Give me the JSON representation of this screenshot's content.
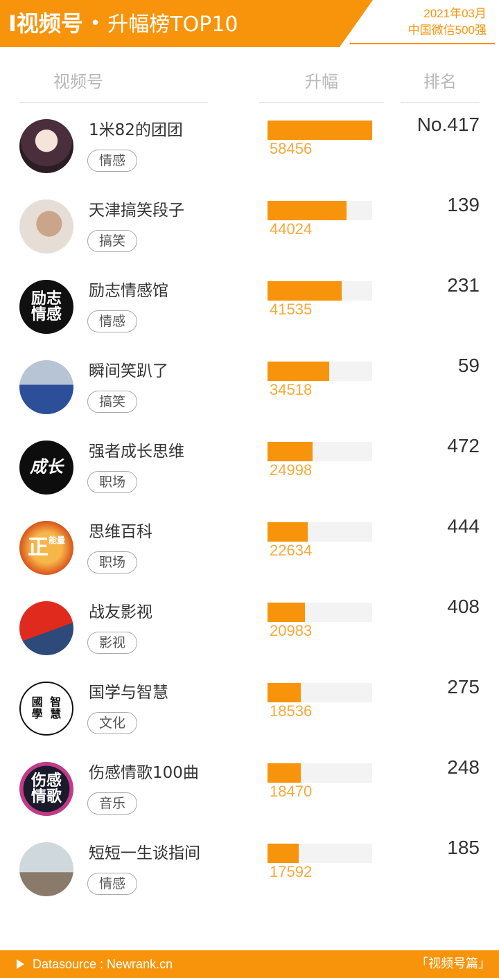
{
  "header": {
    "title_main": "I视频号",
    "title_dot": "•",
    "title_sub": "升幅榜TOP10",
    "date": "2021年03月",
    "subtitle": "中国微信500强"
  },
  "columns": {
    "account": "视频号",
    "increase": "升幅",
    "rank": "排名"
  },
  "bar_max": 58456,
  "rows": [
    {
      "name": "1米82的团团",
      "tag": "情感",
      "value": 58456,
      "value_label": "58456",
      "rank": "No.417",
      "avatar_icon": "anime-girl-avatar-icon"
    },
    {
      "name": "天津搞笑段子",
      "tag": "搞笑",
      "value": 44024,
      "value_label": "44024",
      "rank": "139",
      "avatar_icon": "woman-photo-avatar-icon"
    },
    {
      "name": "励志情感馆",
      "tag": "情感",
      "value": 41535,
      "value_label": "41535",
      "rank": "231",
      "avatar_icon": "text-logo-avatar-icon",
      "avatar_text": [
        "励志",
        "情感"
      ]
    },
    {
      "name": "瞬间笑趴了",
      "tag": "搞笑",
      "value": 34518,
      "value_label": "34518",
      "rank": "59",
      "avatar_icon": "man-on-tricycle-avatar-icon"
    },
    {
      "name": "强者成长思维",
      "tag": "职场",
      "value": 24998,
      "value_label": "24998",
      "rank": "472",
      "avatar_icon": "calligraphy-avatar-icon",
      "avatar_text": [
        "成长"
      ]
    },
    {
      "name": "思维百科",
      "tag": "职场",
      "value": 22634,
      "value_label": "22634",
      "rank": "444",
      "avatar_icon": "positive-energy-avatar-icon",
      "avatar_text": [
        "正",
        "能量"
      ]
    },
    {
      "name": "战友影视",
      "tag": "影视",
      "value": 20983,
      "value_label": "20983",
      "rank": "408",
      "avatar_icon": "flag-soldiers-avatar-icon"
    },
    {
      "name": "国学与智慧",
      "tag": "文化",
      "value": 18536,
      "value_label": "18536",
      "rank": "275",
      "avatar_icon": "seal-avatar-icon",
      "avatar_text": [
        "國",
        "智",
        "學",
        "慧"
      ]
    },
    {
      "name": "伤感情歌100曲",
      "tag": "音乐",
      "value": 18470,
      "value_label": "18470",
      "rank": "248",
      "avatar_icon": "text-logo-avatar-icon",
      "avatar_text": [
        "伤感",
        "情歌"
      ]
    },
    {
      "name": "短短一生谈指间",
      "tag": "情感",
      "value": 17592,
      "value_label": "17592",
      "rank": "185",
      "avatar_icon": "raised-hands-avatar-icon"
    }
  ],
  "footer": {
    "source": "Datasource : Newrank.cn",
    "brand": "「视频号篇」"
  },
  "colors": {
    "accent": "#f7940c",
    "bar_track": "#f3f3f3",
    "value_text": "#f7a93a"
  }
}
